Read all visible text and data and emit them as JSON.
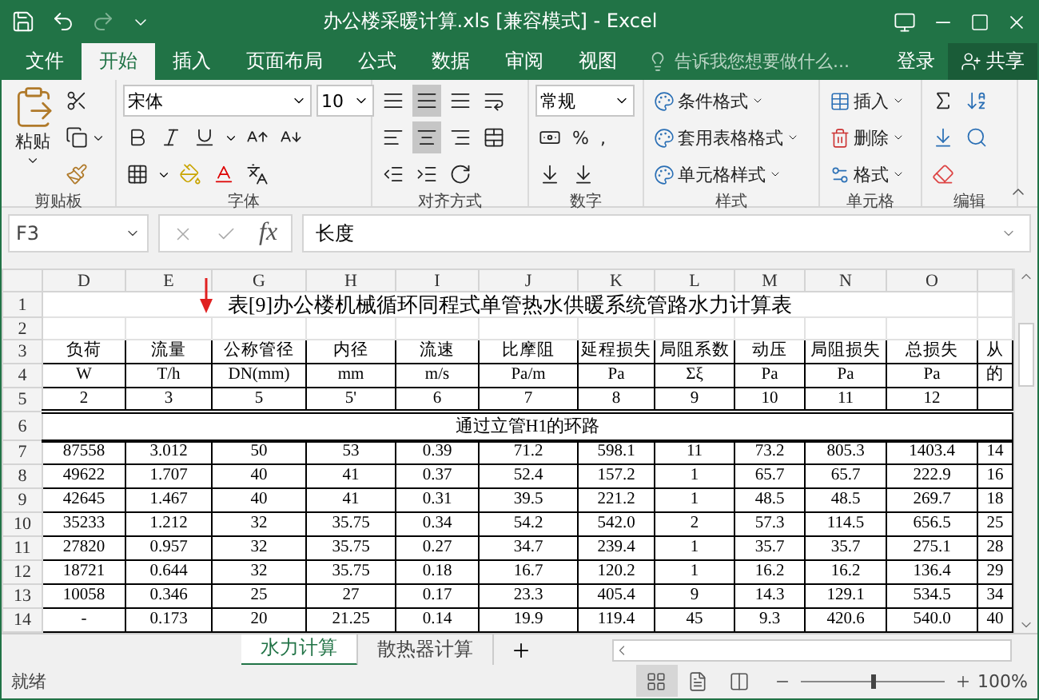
{
  "window": {
    "title": "办公楼采暖计算.xls  [兼容模式] - Excel"
  },
  "menu_tabs": [
    {
      "label": "文件",
      "selected": false
    },
    {
      "label": "开始",
      "selected": true
    },
    {
      "label": "插入",
      "selected": false
    },
    {
      "label": "页面布局",
      "selected": false
    },
    {
      "label": "公式",
      "selected": false
    },
    {
      "label": "数据",
      "selected": false
    },
    {
      "label": "审阅",
      "selected": false
    },
    {
      "label": "视图",
      "selected": false
    }
  ],
  "tell_me": {
    "placeholder": "告诉我您想要做什么..."
  },
  "account": {
    "sign_in": "登录",
    "share": "共享"
  },
  "ribbon": {
    "clipboard": {
      "paste": "粘贴",
      "label": "剪贴板"
    },
    "font": {
      "font_name": "宋体",
      "font_size": "10",
      "label": "字体"
    },
    "alignment": {
      "label": "对齐方式"
    },
    "number": {
      "format": "常规",
      "percent": "%",
      "comma": ",",
      "label": "数字"
    },
    "styles": {
      "items": [
        "条件格式",
        "套用表格格式",
        "单元格样式"
      ],
      "label": "样式"
    },
    "cells": {
      "items": [
        "插入",
        "删除",
        "格式"
      ],
      "label": "单元格"
    },
    "editing": {
      "label": "编辑"
    }
  },
  "formula_bar": {
    "name_box": "F3",
    "fx_label": "fx",
    "content": "长度"
  },
  "sheet": {
    "columns": [
      "D",
      "E",
      "G",
      "H",
      "I",
      "J",
      "K",
      "L",
      "M",
      "N",
      "O"
    ],
    "rows": [
      {
        "number": "1",
        "kind": "title",
        "text": "表[9]办公楼机械循环同程式单管热水供暖系统管路水力计算表"
      },
      {
        "number": "2",
        "kind": "blank"
      },
      {
        "number": "3",
        "kind": "cells",
        "cells": [
          "负荷",
          "流量",
          "公称管径",
          "内径",
          "流速",
          "比摩阻",
          "延程损失",
          "局阻系数",
          "动压",
          "局阻损失",
          "总损失",
          "从"
        ]
      },
      {
        "number": "4",
        "kind": "cells",
        "cells": [
          "W",
          "T/h",
          "DN(mm)",
          "mm",
          "m/s",
          "Pa/m",
          "Pa",
          "Σξ",
          "Pa",
          "Pa",
          "Pa",
          "的"
        ]
      },
      {
        "number": "5",
        "kind": "cells",
        "cells": [
          "2",
          "3",
          "5",
          "5'",
          "6",
          "7",
          "8",
          "9",
          "10",
          "11",
          "12"
        ]
      },
      {
        "number": "6",
        "kind": "section",
        "text": "通过立管H1的环路"
      },
      {
        "number": "7",
        "kind": "cells",
        "cells": [
          "87558",
          "3.012",
          "50",
          "53",
          "0.39",
          "71.2",
          "598.1",
          "11",
          "73.2",
          "805.3",
          "1403.4",
          "14"
        ]
      },
      {
        "number": "8",
        "kind": "cells",
        "cells": [
          "49622",
          "1.707",
          "40",
          "41",
          "0.37",
          "52.4",
          "157.2",
          "1",
          "65.7",
          "65.7",
          "222.9",
          "16"
        ]
      },
      {
        "number": "9",
        "kind": "cells",
        "cells": [
          "42645",
          "1.467",
          "40",
          "41",
          "0.31",
          "39.5",
          "221.2",
          "1",
          "48.5",
          "48.5",
          "269.7",
          "18"
        ]
      },
      {
        "number": "10",
        "kind": "cells",
        "cells": [
          "35233",
          "1.212",
          "32",
          "35.75",
          "0.34",
          "54.2",
          "542.0",
          "2",
          "57.3",
          "114.5",
          "656.5",
          "25"
        ]
      },
      {
        "number": "11",
        "kind": "cells",
        "cells": [
          "27820",
          "0.957",
          "32",
          "35.75",
          "0.27",
          "34.7",
          "239.4",
          "1",
          "35.7",
          "35.7",
          "275.1",
          "28"
        ]
      },
      {
        "number": "12",
        "kind": "cells",
        "cells": [
          "18721",
          "0.644",
          "32",
          "35.75",
          "0.18",
          "16.7",
          "120.2",
          "1",
          "16.2",
          "16.2",
          "136.4",
          "29"
        ]
      },
      {
        "number": "13",
        "kind": "cells",
        "cells": [
          "10058",
          "0.346",
          "25",
          "27",
          "0.17",
          "23.3",
          "405.4",
          "9",
          "14.3",
          "129.1",
          "534.5",
          "34"
        ]
      },
      {
        "number": "14",
        "kind": "cells",
        "cells": [
          "-",
          "0.173",
          "20",
          "21.25",
          "0.14",
          "19.9",
          "119.4",
          "45",
          "9.3",
          "420.6",
          "540.0",
          "40"
        ]
      }
    ]
  },
  "sheet_tabs": [
    {
      "label": "水力计算",
      "selected": true
    },
    {
      "label": "散热器计算",
      "selected": false
    }
  ],
  "status_bar": {
    "status": "就绪",
    "zoom": "100%",
    "zoom_slider": {
      "level": 0.5
    },
    "views": [
      {
        "kind": "normal",
        "selected": true
      },
      {
        "kind": "page_layout",
        "selected": false
      },
      {
        "kind": "page_break",
        "selected": false
      }
    ]
  }
}
